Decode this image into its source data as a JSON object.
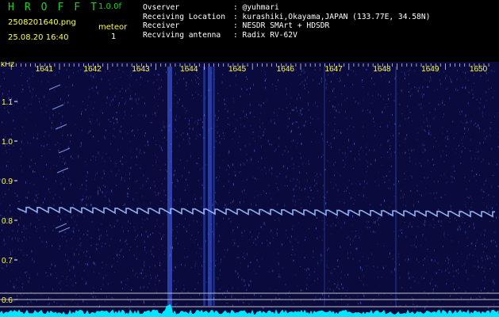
{
  "header": {
    "logo": "HROFFT",
    "version": "1.0.0f",
    "filename": "2508201640.png",
    "datetime": "25.08.20 16:40",
    "meteor_label": "meteor",
    "meteor_count": "1",
    "info": [
      {
        "key": "Ovserver",
        "value": ": @yuhmari"
      },
      {
        "key": "Receiving Location",
        "value": ": kurashiki,Okayama,JAPAN (133.77E, 34.58N)"
      },
      {
        "key": "Receiver",
        "value": ": NESDR SMArt + HDSDR"
      },
      {
        "key": "Recviving antenna",
        "value": ": Radix RV-62V"
      }
    ]
  },
  "chart_data": {
    "type": "heatmap",
    "xlabel": "",
    "ylabel": "kHz",
    "x_ticks": [
      "1641",
      "1642",
      "1643",
      "1644",
      "1645",
      "1646",
      "1647",
      "1648",
      "1649",
      "1650"
    ],
    "y_ticks": [
      "1.1",
      "1.0",
      "0.9",
      "0.8",
      "0.7",
      "0.6"
    ],
    "ylim": [
      0.58,
      1.18
    ],
    "colors": {
      "background": "#0a0a3c",
      "signal": "#6f9cff",
      "axis": "#ffff40",
      "spectrum": "#00e5ff"
    }
  }
}
